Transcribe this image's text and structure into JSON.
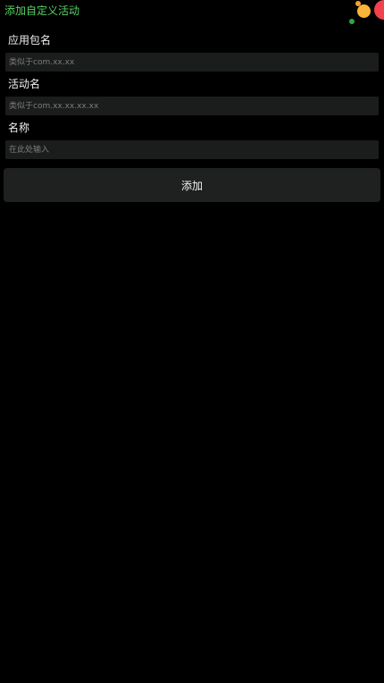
{
  "header": {
    "title": "添加自定义活动"
  },
  "form": {
    "package": {
      "label": "应用包名",
      "value": "",
      "placeholder": "类似于com.xx.xx"
    },
    "activity": {
      "label": "活动名",
      "value": "",
      "placeholder": "类似于com.xx.xx.xx.xx"
    },
    "name": {
      "label": "名称",
      "value": "",
      "placeholder": "在此处输入"
    }
  },
  "actions": {
    "add_label": "添加"
  },
  "colors": {
    "background": "#000000",
    "title": "#57d163",
    "input_background": "#1b1c1c",
    "button_background": "#1f2020",
    "decoration_orange": "#f9b53a",
    "decoration_red": "#f2424e",
    "decoration_green": "#2fa83f"
  }
}
